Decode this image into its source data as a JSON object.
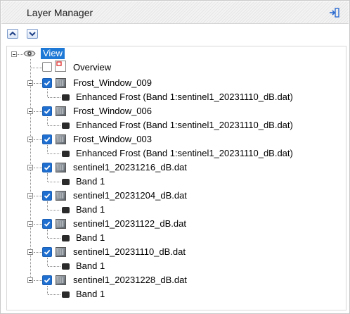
{
  "panel": {
    "title": "Layer Manager",
    "pin_icon": "pin-icon"
  },
  "toolbar": {
    "expand_icon": "chevron-up-icon",
    "collapse_icon": "chevron-down-icon"
  },
  "tree": {
    "root_label": "View",
    "overview_label": "Overview",
    "layers": [
      {
        "name": "Frost_Window_009",
        "child": "Enhanced Frost (Band 1:sentinel1_20231110_dB.dat)",
        "checked": true
      },
      {
        "name": "Frost_Window_006",
        "child": "Enhanced Frost (Band 1:sentinel1_20231110_dB.dat)",
        "checked": true
      },
      {
        "name": "Frost_Window_003",
        "child": "Enhanced Frost (Band 1:sentinel1_20231110_dB.dat)",
        "checked": true
      },
      {
        "name": "sentinel1_20231216_dB.dat",
        "child": "Band 1",
        "checked": true
      },
      {
        "name": "sentinel1_20231204_dB.dat",
        "child": "Band 1",
        "checked": true
      },
      {
        "name": "sentinel1_20231122_dB.dat",
        "child": "Band 1",
        "checked": true
      },
      {
        "name": "sentinel1_20231110_dB.dat",
        "child": "Band 1",
        "checked": true
      },
      {
        "name": "sentinel1_20231228_dB.dat",
        "child": "Band 1",
        "checked": true
      }
    ]
  },
  "colors": {
    "accent": "#1f6fd1",
    "selection": "#1e78d6"
  }
}
